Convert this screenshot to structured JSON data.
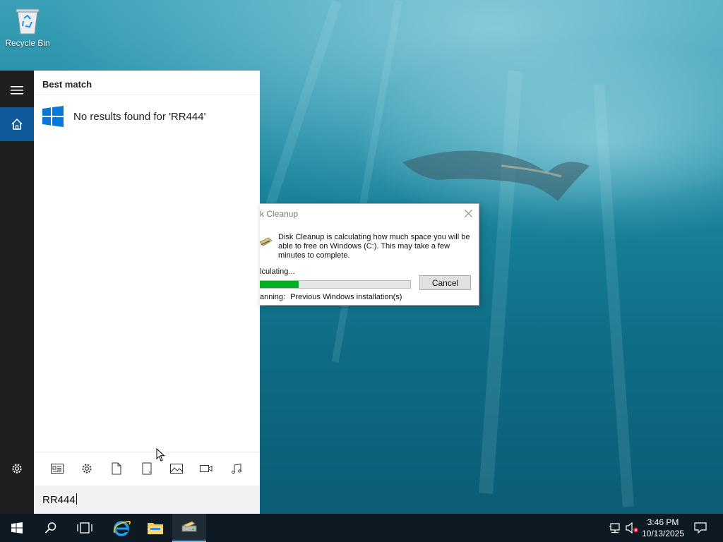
{
  "desktop": {
    "recycle_bin_label": "Recycle Bin"
  },
  "start": {
    "best_match_label": "Best match",
    "no_results_text": "No results found for 'RR444'",
    "search_value": "RR444",
    "filter_icons": [
      "apps-icon",
      "settings-icon",
      "documents-icon",
      "folders-icon",
      "photos-icon",
      "videos-icon",
      "music-icon"
    ]
  },
  "dialog": {
    "title": "k Cleanup",
    "message": "Disk Cleanup is calculating how much space you will be able to free on Windows (C:). This may take a few minutes to complete.",
    "calculating": "lculating...",
    "progress_fraction": 0.26,
    "cancel_label": "Cancel",
    "scanning_label": "anning:",
    "scanning_value": "Previous Windows installation(s)"
  },
  "taskbar": {
    "time": "3:46 PM",
    "date": "10/13/2025"
  },
  "colors": {
    "accent": "#0e5a9b",
    "progress": "#06b025",
    "taskbar": "#0d1a24"
  }
}
